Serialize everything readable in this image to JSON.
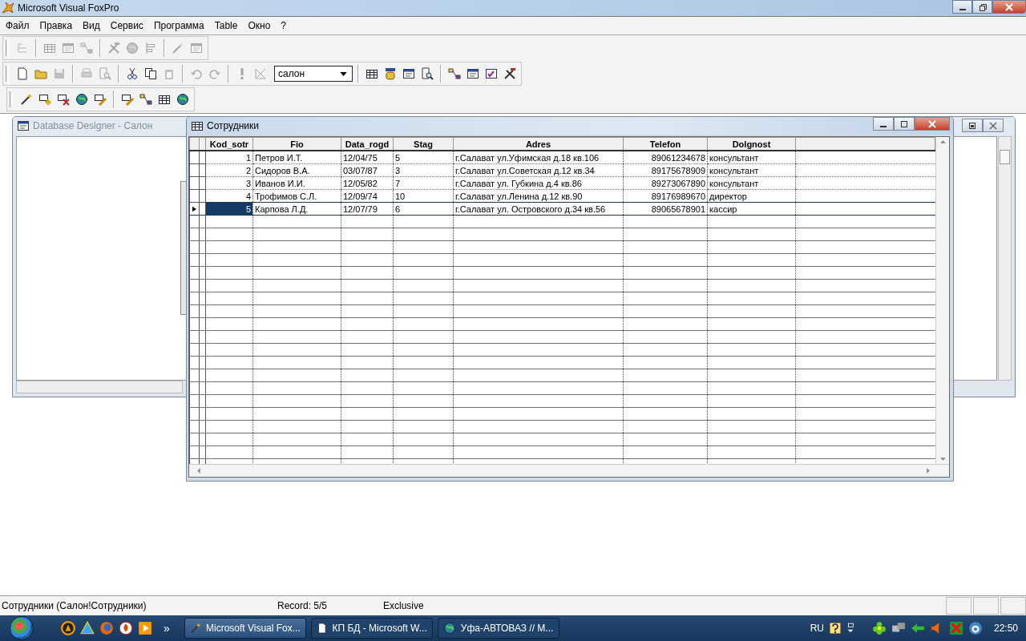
{
  "window": {
    "title": "Microsoft Visual FoxPro"
  },
  "menu": [
    "Файл",
    "Правка",
    "Вид",
    "Сервис",
    "Программа",
    "Table",
    "Окно",
    "?"
  ],
  "toolbars": [
    {
      "groups": [
        [
          {
            "disabled": true
          }
        ],
        [
          {
            "disabled": true
          },
          {
            "disabled": true
          },
          {
            "disabled": true
          }
        ],
        [
          {
            "disabled": true
          },
          {
            "disabled": true
          },
          {
            "disabled": true
          }
        ],
        [
          {
            "disabled": true
          },
          {
            "disabled": true
          }
        ]
      ]
    },
    {
      "groups": [
        [
          {
            "disabled": false
          },
          {
            "disabled": false
          },
          {
            "disabled": true
          }
        ],
        [
          {
            "disabled": true
          },
          {
            "disabled": true
          }
        ],
        [
          {
            "disabled": false
          },
          {
            "disabled": false
          },
          {
            "disabled": true
          }
        ],
        [
          {
            "disabled": true
          },
          {
            "disabled": true
          }
        ],
        [
          {
            "disabled": true
          },
          {
            "disabled": true
          }
        ],
        [
          {
            "disabled": false
          },
          {
            "disabled": false
          },
          {
            "disabled": false
          },
          {
            "disabled": false
          }
        ],
        [
          {
            "disabled": false
          },
          {
            "disabled": false
          },
          {
            "disabled": false
          },
          {
            "disabled": false
          }
        ]
      ],
      "combo": {
        "value": "салон"
      }
    },
    {
      "groups": [
        [
          {
            "disabled": false
          },
          {
            "disabled": false
          },
          {
            "disabled": false
          },
          {
            "disabled": false
          },
          {
            "disabled": false
          }
        ],
        [
          {
            "disabled": false
          },
          {
            "disabled": false
          },
          {
            "disabled": false
          },
          {
            "disabled": false
          }
        ]
      ]
    }
  ],
  "designer": {
    "title": "Database Designer - Салон",
    "active": false
  },
  "browse": {
    "title": "Сотрудники",
    "active": true,
    "columns": [
      {
        "label": "Kod_sotr",
        "kind": "number"
      },
      {
        "label": "Fio",
        "kind": "text"
      },
      {
        "label": "Data_rogd",
        "kind": "text"
      },
      {
        "label": "Stag",
        "kind": "text"
      },
      {
        "label": "Adres",
        "kind": "text"
      },
      {
        "label": "Telefon",
        "kind": "number"
      },
      {
        "label": "Dolgnost",
        "kind": "text"
      }
    ],
    "rows": [
      {
        "selected": false,
        "cells": [
          "1",
          "Петров И.Т.",
          "12/04/75",
          "5",
          "г.Салават ул.Уфимская д.18 кв.106",
          "89061234678",
          "консультант"
        ]
      },
      {
        "selected": false,
        "cells": [
          "2",
          "Сидоров В.А.",
          "03/07/87",
          "3",
          "г.Салават ул.Советская д.12 кв.34",
          "89175678909",
          "консультант"
        ]
      },
      {
        "selected": false,
        "cells": [
          "3",
          "Иванов И.И.",
          "12/05/82",
          "7",
          "г.Салават ул. Губкина д.4 кв.86",
          "89273067890",
          "консультант"
        ]
      },
      {
        "selected": false,
        "cells": [
          "4",
          "Трофимов С.Л.",
          "12/09/74",
          "10",
          "г.Салават ул.Ленина д.12 кв.90",
          "89176989670",
          "директор"
        ]
      },
      {
        "selected": true,
        "cells": [
          "5",
          "Карпова Л.Д.",
          "12/07/79",
          "6",
          "г.Салават ул. Островского д.34 кв.56",
          "89065678901",
          "кассир"
        ]
      }
    ]
  },
  "status_bar": [
    "Сотрудники (Салон!Сотрудники)",
    "Record: 5/5",
    "Exclusive"
  ],
  "taskbar": {
    "chevron": "»",
    "tasks": [
      {
        "label": "Microsoft Visual Fox...",
        "selected": true
      },
      {
        "label": "КП БД - Microsoft W...",
        "selected": false
      },
      {
        "label": "Уфа-АВТОВАЗ // М...",
        "selected": false
      }
    ],
    "language": "RU",
    "clock": "22:50"
  }
}
